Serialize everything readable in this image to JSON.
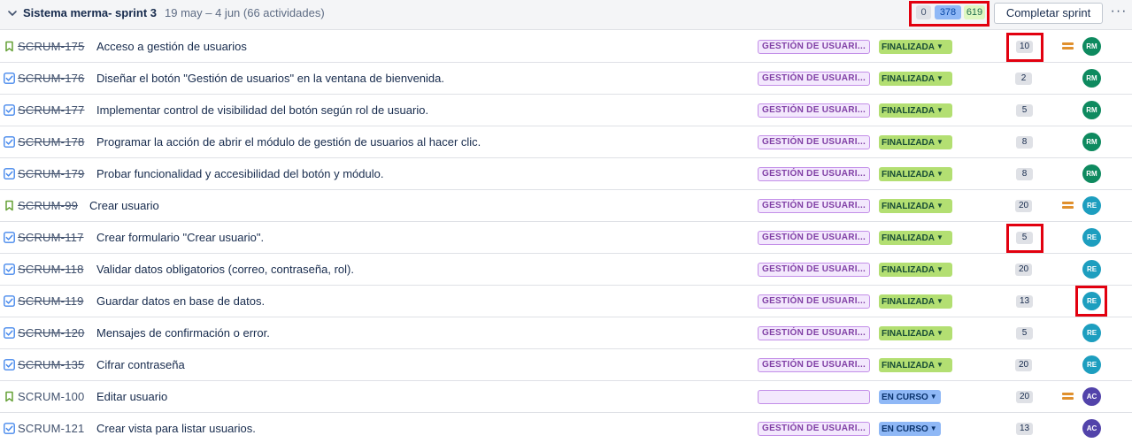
{
  "sprint": {
    "name": "Sistema merma- sprint 3",
    "dates": "19 may – 4 jun (66 actividades)",
    "counts": {
      "todo": "0",
      "in_progress": "378",
      "done": "619"
    },
    "complete_label": "Completar sprint",
    "more_label": "···"
  },
  "colors": {
    "done_status": "#b3df72",
    "in_progress_status": "#8fb8f6",
    "epic": "#f3e8fd",
    "highlight": "#e2000f"
  },
  "issues": [
    {
      "type": "story",
      "key": "SCRUM-175",
      "summary": "Acceso a gestión de usuarios",
      "epic": "GESTIÓN DE USUARI...",
      "status": "FINALIZADA",
      "points": "10",
      "priority": "medium",
      "assignee": "RM",
      "avatar_color": "#0e8a5f"
    },
    {
      "type": "task",
      "key": "SCRUM-176",
      "summary": "Diseñar el botón \"Gestión de usuarios\" en la ventana de bienvenida.",
      "epic": "GESTIÓN DE USUARI...",
      "status": "FINALIZADA",
      "points": "2",
      "priority": "",
      "assignee": "RM",
      "avatar_color": "#0e8a5f"
    },
    {
      "type": "task",
      "key": "SCRUM-177",
      "summary": "Implementar control de visibilidad del botón según rol de usuario.",
      "epic": "GESTIÓN DE USUARI...",
      "status": "FINALIZADA",
      "points": "5",
      "priority": "",
      "assignee": "RM",
      "avatar_color": "#0e8a5f"
    },
    {
      "type": "task",
      "key": "SCRUM-178",
      "summary": "Programar la acción de abrir el módulo de gestión de usuarios al hacer clic.",
      "epic": "GESTIÓN DE USUARI...",
      "status": "FINALIZADA",
      "points": "8",
      "priority": "",
      "assignee": "RM",
      "avatar_color": "#0e8a5f"
    },
    {
      "type": "task",
      "key": "SCRUM-179",
      "summary": "Probar funcionalidad y accesibilidad del botón y módulo.",
      "epic": "GESTIÓN DE USUARI...",
      "status": "FINALIZADA",
      "points": "8",
      "priority": "",
      "assignee": "RM",
      "avatar_color": "#0e8a5f"
    },
    {
      "type": "story",
      "key": "SCRUM-99",
      "summary": "Crear usuario",
      "epic": "GESTIÓN DE USUARI...",
      "status": "FINALIZADA",
      "points": "20",
      "priority": "medium",
      "assignee": "RE",
      "avatar_color": "#1d9ebf"
    },
    {
      "type": "task",
      "key": "SCRUM-117",
      "summary": "Crear formulario \"Crear usuario\".",
      "epic": "GESTIÓN DE USUARI...",
      "status": "FINALIZADA",
      "points": "5",
      "priority": "",
      "assignee": "RE",
      "avatar_color": "#1d9ebf"
    },
    {
      "type": "task",
      "key": "SCRUM-118",
      "summary": "Validar datos obligatorios (correo, contraseña, rol).",
      "epic": "GESTIÓN DE USUARI...",
      "status": "FINALIZADA",
      "points": "20",
      "priority": "",
      "assignee": "RE",
      "avatar_color": "#1d9ebf"
    },
    {
      "type": "task",
      "key": "SCRUM-119",
      "summary": "Guardar datos en base de datos.",
      "epic": "GESTIÓN DE USUARI...",
      "status": "FINALIZADA",
      "points": "13",
      "priority": "",
      "assignee": "RE",
      "avatar_color": "#1d9ebf"
    },
    {
      "type": "task",
      "key": "SCRUM-120",
      "summary": "Mensajes de confirmación o error.",
      "epic": "GESTIÓN DE USUARI...",
      "status": "FINALIZADA",
      "points": "5",
      "priority": "",
      "assignee": "RE",
      "avatar_color": "#1d9ebf"
    },
    {
      "type": "task",
      "key": "SCRUM-135",
      "summary": "Cifrar contraseña",
      "epic": "GESTIÓN DE USUARI...",
      "status": "FINALIZADA",
      "points": "20",
      "priority": "",
      "assignee": "RE",
      "avatar_color": "#1d9ebf"
    },
    {
      "type": "story",
      "key": "SCRUM-100",
      "summary": "Editar usuario",
      "epic": "",
      "status": "EN CURSO",
      "points": "20",
      "priority": "medium",
      "assignee": "AC",
      "avatar_color": "#5243aa"
    },
    {
      "type": "task",
      "key": "SCRUM-121",
      "summary": "Crear vista para listar usuarios.",
      "epic": "GESTIÓN DE USUARI...",
      "status": "EN CURSO",
      "points": "13",
      "priority": "",
      "assignee": "AC",
      "avatar_color": "#5243aa"
    }
  ]
}
